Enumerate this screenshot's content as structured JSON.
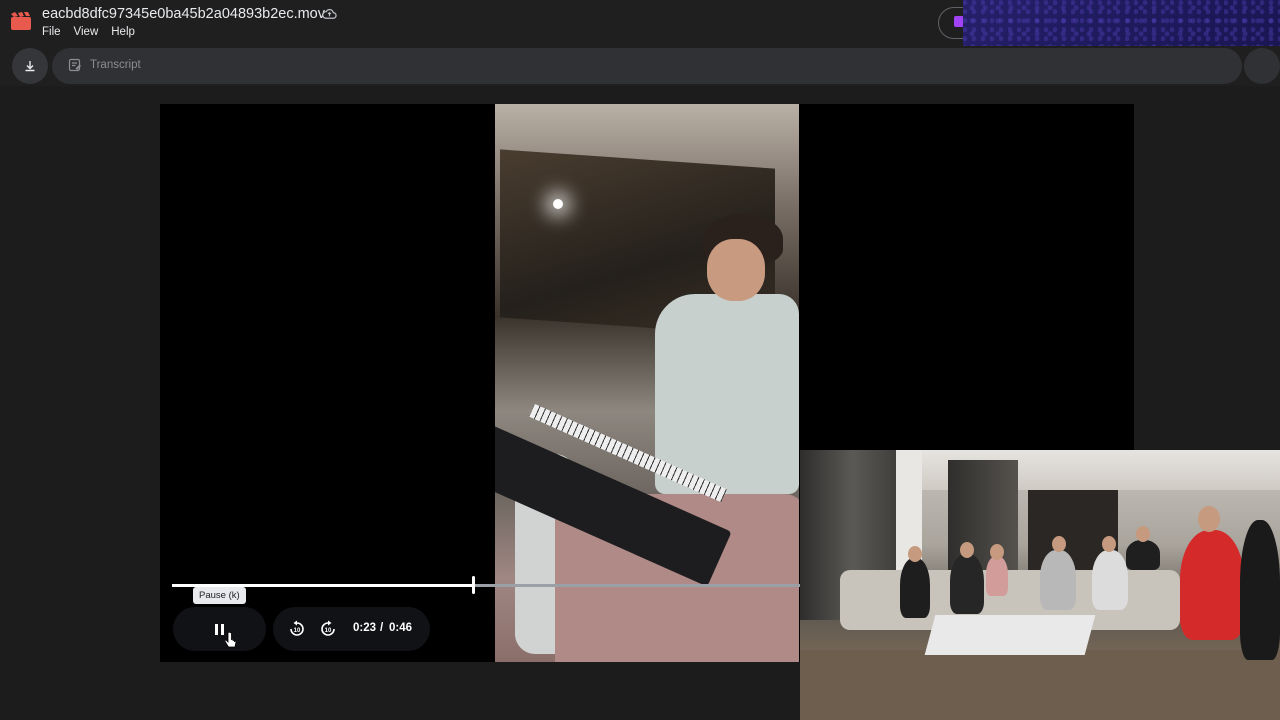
{
  "window": {
    "file_name": "eacbd8dfc97345e0ba45b2a04893b2ec.mov"
  },
  "menu": [
    "File",
    "View",
    "Help"
  ],
  "toolbar": {
    "transcript_label": "Transcript"
  },
  "player": {
    "tooltip": "Pause (k)",
    "time_current": "0:23",
    "time_separator": "/",
    "time_total": "0:46",
    "progress_fraction": 0.5
  },
  "colors": {
    "app_icon": "#e8594e",
    "accent_purple": "#a142f4",
    "background": "#1c1c1c",
    "player_bg": "#000000"
  },
  "icons": {
    "app": "clapperboard-icon",
    "drive_status": "cloud-upload-icon",
    "download": "download-icon",
    "transcript": "transcript-icon",
    "pause": "pause-icon",
    "rewind": "rewind-10-icon",
    "forward": "forward-10-icon",
    "cursor": "cursor-hand-icon"
  }
}
